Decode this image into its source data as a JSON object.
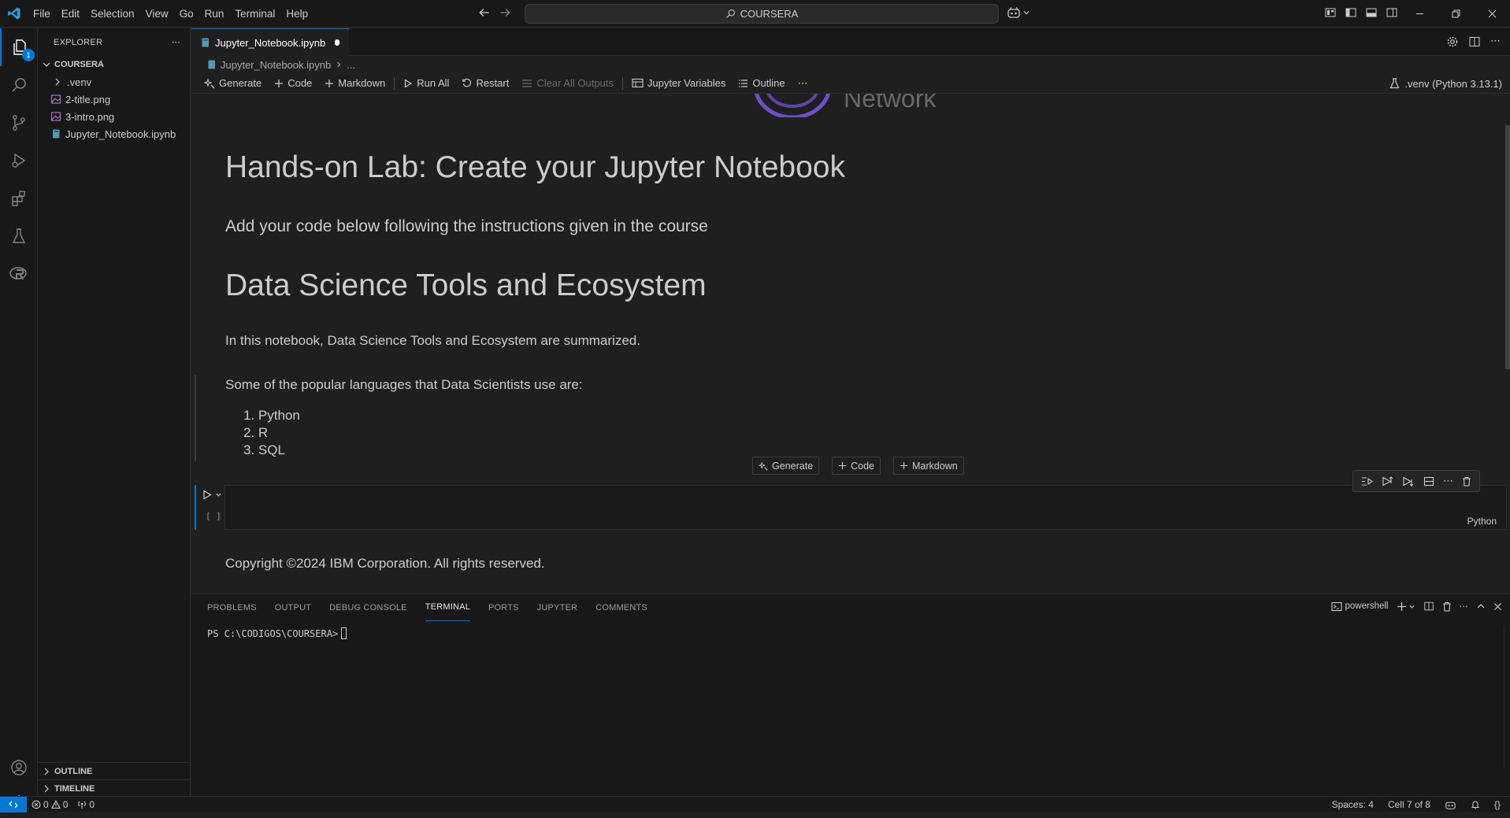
{
  "menu": [
    "File",
    "Edit",
    "Selection",
    "View",
    "Go",
    "Run",
    "Terminal",
    "Help"
  ],
  "command_center": {
    "text": "COURSERA"
  },
  "activity": {
    "explorer_badge": "1"
  },
  "sidebar": {
    "title": "EXPLORER",
    "folder": "COURSERA",
    "items": [
      {
        "label": ".venv",
        "type": "folder"
      },
      {
        "label": "2-title.png",
        "type": "image"
      },
      {
        "label": "3-intro.png",
        "type": "image"
      },
      {
        "label": "Jupyter_Notebook.ipynb",
        "type": "notebook"
      }
    ],
    "outline_label": "OUTLINE",
    "timeline_label": "TIMELINE"
  },
  "tab": {
    "label": "Jupyter_Notebook.ipynb"
  },
  "breadcrumb": {
    "file": "Jupyter_Notebook.ipynb",
    "more": "..."
  },
  "toolbar": {
    "generate": "Generate",
    "code": "Code",
    "markdown": "Markdown",
    "run_all": "Run All",
    "restart": "Restart",
    "clear_outputs": "Clear All Outputs",
    "variables": "Jupyter Variables",
    "outline": "Outline",
    "more": "⋯",
    "kernel": ".venv (Python 3.13.1)"
  },
  "notebook": {
    "logo_text": "Network",
    "heading_lab": "Hands-on Lab: Create your Jupyter Notebook",
    "instructions": "Add your code below following the instructions given in the course",
    "heading_ds": "Data Science Tools and Ecosystem",
    "summary": "In this notebook, Data Science Tools and Ecosystem are summarized.",
    "languages_intro": "Some of the popular languages that Data Scientists use are:",
    "languages": [
      "1. Python",
      "2. R",
      "3. SQL"
    ],
    "insert": {
      "generate": "Generate",
      "code": "Code",
      "markdown": "Markdown"
    },
    "code_cell": {
      "exec_count": "[ ]",
      "language": "Python"
    },
    "copyright": "Copyright ©2024 IBM Corporation. All rights reserved."
  },
  "panel": {
    "tabs": [
      "PROBLEMS",
      "OUTPUT",
      "DEBUG CONSOLE",
      "TERMINAL",
      "PORTS",
      "JUPYTER",
      "COMMENTS"
    ],
    "active_tab": "TERMINAL",
    "shell": "powershell",
    "prompt": "PS C:\\CODIGOS\\COURSERA>"
  },
  "status": {
    "errors": "0",
    "warnings": "0",
    "ports": "0",
    "spaces": "Spaces: 4",
    "cell": "Cell 7 of 8",
    "braces": "{}"
  },
  "colors": {
    "accent": "#0078d4",
    "bg": "#1f1f1f",
    "sidebar_bg": "#181818"
  }
}
